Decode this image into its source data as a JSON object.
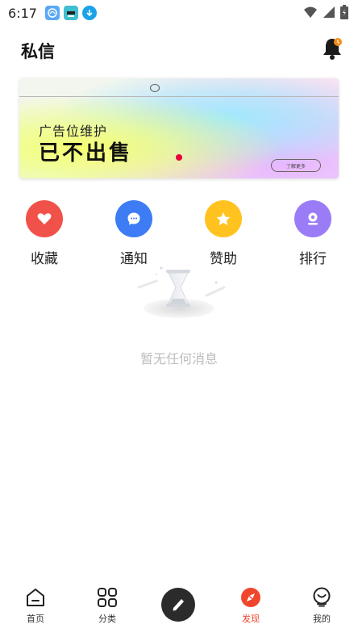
{
  "status_bar": {
    "time": "6:17",
    "wifi_icon": "wifi-icon",
    "signal_icon": "signal-icon",
    "battery_icon": "battery-icon"
  },
  "header": {
    "title": "私信",
    "bell_icon": "bell-icon"
  },
  "banner": {
    "subtitle": "广告位维护",
    "headline": "已不出售",
    "button_label": "了解更多"
  },
  "actions": [
    {
      "label": "收藏",
      "icon": "heart-icon",
      "color": "#f0524a"
    },
    {
      "label": "通知",
      "icon": "chat-bubble-icon",
      "color": "#3d7cf5"
    },
    {
      "label": "赞助",
      "icon": "star-icon",
      "color": "#ffc21f"
    },
    {
      "label": "排行",
      "icon": "person-icon",
      "color": "#9b7cf7"
    }
  ],
  "empty_state": {
    "message": "暂无任何消息",
    "icon": "hourglass-icon"
  },
  "bottom_nav": {
    "items": [
      {
        "label": "首页",
        "icon": "home-icon"
      },
      {
        "label": "分类",
        "icon": "grid-icon"
      },
      {
        "label": "",
        "icon": "pen-icon"
      },
      {
        "label": "发现",
        "icon": "compass-icon",
        "active_color": "#f0462e"
      },
      {
        "label": "我的",
        "icon": "smile-icon"
      }
    ]
  }
}
